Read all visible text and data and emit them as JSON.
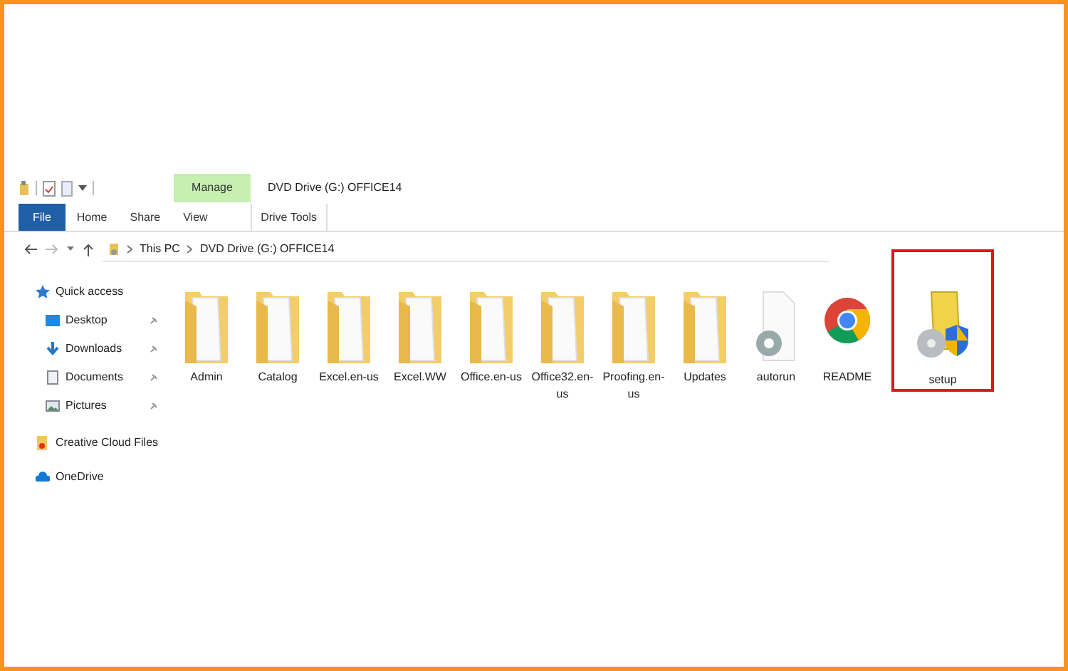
{
  "window": {
    "title": "DVD Drive (G:) OFFICE14"
  },
  "context_tab": {
    "group": "Manage",
    "label": "Drive Tools"
  },
  "ribbon_tabs": [
    {
      "label": "File",
      "kind": "file"
    },
    {
      "label": "Home",
      "kind": "tab"
    },
    {
      "label": "Share",
      "kind": "tab"
    },
    {
      "label": "View",
      "kind": "tab"
    }
  ],
  "address": {
    "crumbs": [
      "This PC",
      "DVD Drive (G:) OFFICE14"
    ]
  },
  "sidebar": {
    "items": [
      {
        "label": "Quick access",
        "kind": "star",
        "pinned": false
      },
      {
        "label": "Desktop",
        "kind": "desktop",
        "pinned": true
      },
      {
        "label": "Downloads",
        "kind": "download",
        "pinned": true
      },
      {
        "label": "Documents",
        "kind": "document",
        "pinned": true
      },
      {
        "label": "Pictures",
        "kind": "pictures",
        "pinned": true
      },
      {
        "label": "Creative Cloud Files",
        "kind": "ccfolder",
        "pinned": false
      },
      {
        "label": "OneDrive",
        "kind": "cloud",
        "pinned": false
      }
    ]
  },
  "files": [
    {
      "name": "Admin",
      "kind": "folder",
      "highlighted": false
    },
    {
      "name": "Catalog",
      "kind": "folder",
      "highlighted": false
    },
    {
      "name": "Excel.en-us",
      "kind": "folder",
      "highlighted": false
    },
    {
      "name": "Excel.WW",
      "kind": "folder",
      "highlighted": false
    },
    {
      "name": "Office.en-us",
      "kind": "folder",
      "highlighted": false
    },
    {
      "name": "Office32.en-us",
      "kind": "folder",
      "highlighted": false
    },
    {
      "name": "Proofing.en-us",
      "kind": "folder",
      "highlighted": false
    },
    {
      "name": "Updates",
      "kind": "folder",
      "highlighted": false
    },
    {
      "name": "autorun",
      "kind": "settings-file",
      "highlighted": false
    },
    {
      "name": "README",
      "kind": "browser",
      "highlighted": false
    },
    {
      "name": "setup",
      "kind": "installer",
      "highlighted": true
    }
  ]
}
